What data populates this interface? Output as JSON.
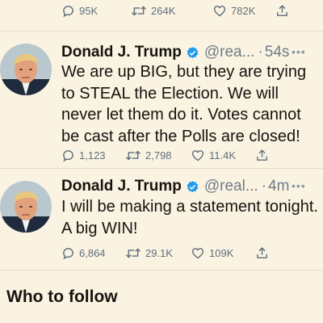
{
  "top_actions": {
    "replies": "95K",
    "retweets": "264K",
    "likes": "782K"
  },
  "tweets": [
    {
      "name": "Donald J. Trump",
      "handle": "@rea...",
      "separator": "·",
      "time": "54s",
      "text": "We are up BIG, but they are trying to STEAL the Election. We will never let them do it. Votes cannot be cast after the Polls are closed!",
      "replies": "1,123",
      "retweets": "2,798",
      "likes": "11.4K"
    },
    {
      "name": "Donald J. Trump",
      "handle": "@real...",
      "separator": "·",
      "time": "4m",
      "text": "I will be making a statement tonight. A big WIN!",
      "replies": "6,864",
      "retweets": "29.1K",
      "likes": "109K"
    }
  ],
  "who_to_follow": "Who to follow",
  "icons": {
    "reply": "reply-icon",
    "retweet": "retweet-icon",
    "like": "like-icon",
    "share": "share-icon",
    "verified": "verified-badge-icon",
    "more": "more-icon"
  },
  "colors": {
    "background": "#fbf3e2",
    "verified": "#1d9bf0",
    "icon": "#5e6f7c"
  }
}
